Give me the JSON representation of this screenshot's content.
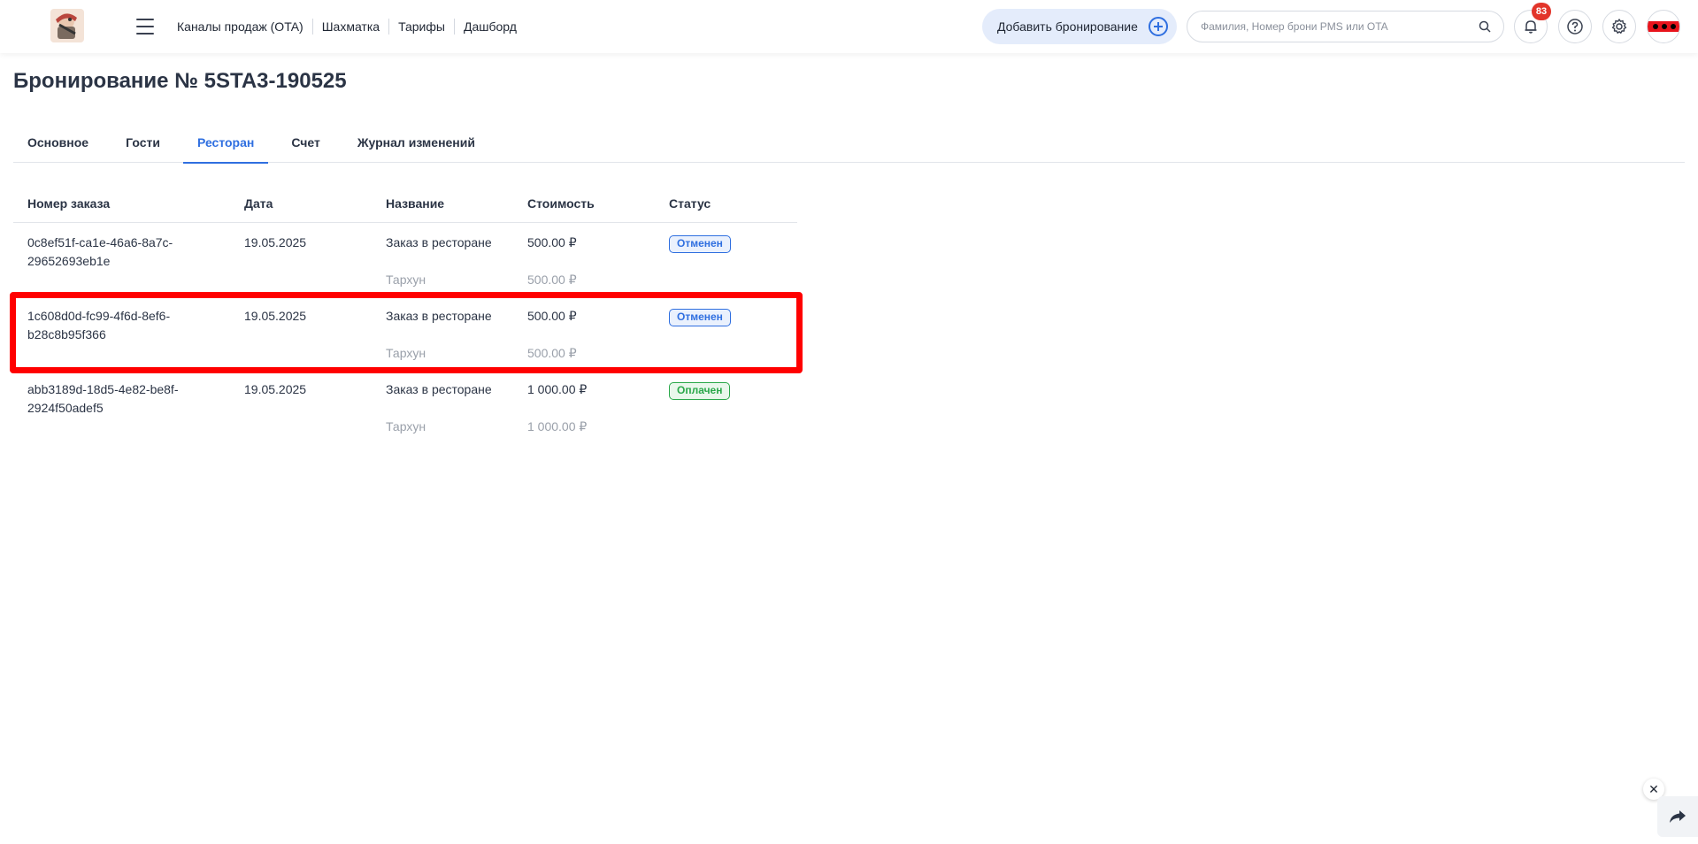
{
  "header": {
    "nav": [
      {
        "label": "Каналы продаж (OTA)"
      },
      {
        "label": "Шахматка"
      },
      {
        "label": "Тарифы"
      },
      {
        "label": "Дашборд"
      }
    ],
    "add_booking_label": "Добавить бронирование",
    "search_placeholder": "Фамилия, Номер брони PMS или OTA",
    "notifications_count": "83"
  },
  "page": {
    "title": "Бронирование № 5STA3-190525"
  },
  "tabs": [
    {
      "label": "Основное",
      "active": false
    },
    {
      "label": "Гости",
      "active": false
    },
    {
      "label": "Ресторан",
      "active": true
    },
    {
      "label": "Счет",
      "active": false
    },
    {
      "label": "Журнал изменений",
      "active": false
    }
  ],
  "table": {
    "headers": [
      "Номер заказа",
      "Дата",
      "Название",
      "Стоимость",
      "Статус"
    ],
    "rows": [
      {
        "order_id": "0c8ef51f-ca1e-46a6-8a7c-29652693eb1e",
        "date": "19.05.2025",
        "name": "Заказ в ресторане",
        "price": "500.00 ₽",
        "status": "Отменен",
        "item_name": "Тархун",
        "item_price": "500.00 ₽"
      },
      {
        "order_id": "1c608d0d-fc99-4f6d-8ef6-b28c8b95f366",
        "date": "19.05.2025",
        "name": "Заказ в ресторане",
        "price": "500.00 ₽",
        "status": "Отменен",
        "item_name": "Тархун",
        "item_price": "500.00 ₽"
      },
      {
        "order_id": "abb3189d-18d5-4e82-be8f-2924f50adef5",
        "date": "19.05.2025",
        "name": "Заказ в ресторане",
        "price": "1 000.00 ₽",
        "status": "Оплачен",
        "item_name": "Тархун",
        "item_price": "1 000.00 ₽"
      }
    ]
  },
  "colors": {
    "accent": "#2f6fe0",
    "paid": "#2aa84a",
    "badge": "#e2352a",
    "highlight": "#ff0000"
  }
}
